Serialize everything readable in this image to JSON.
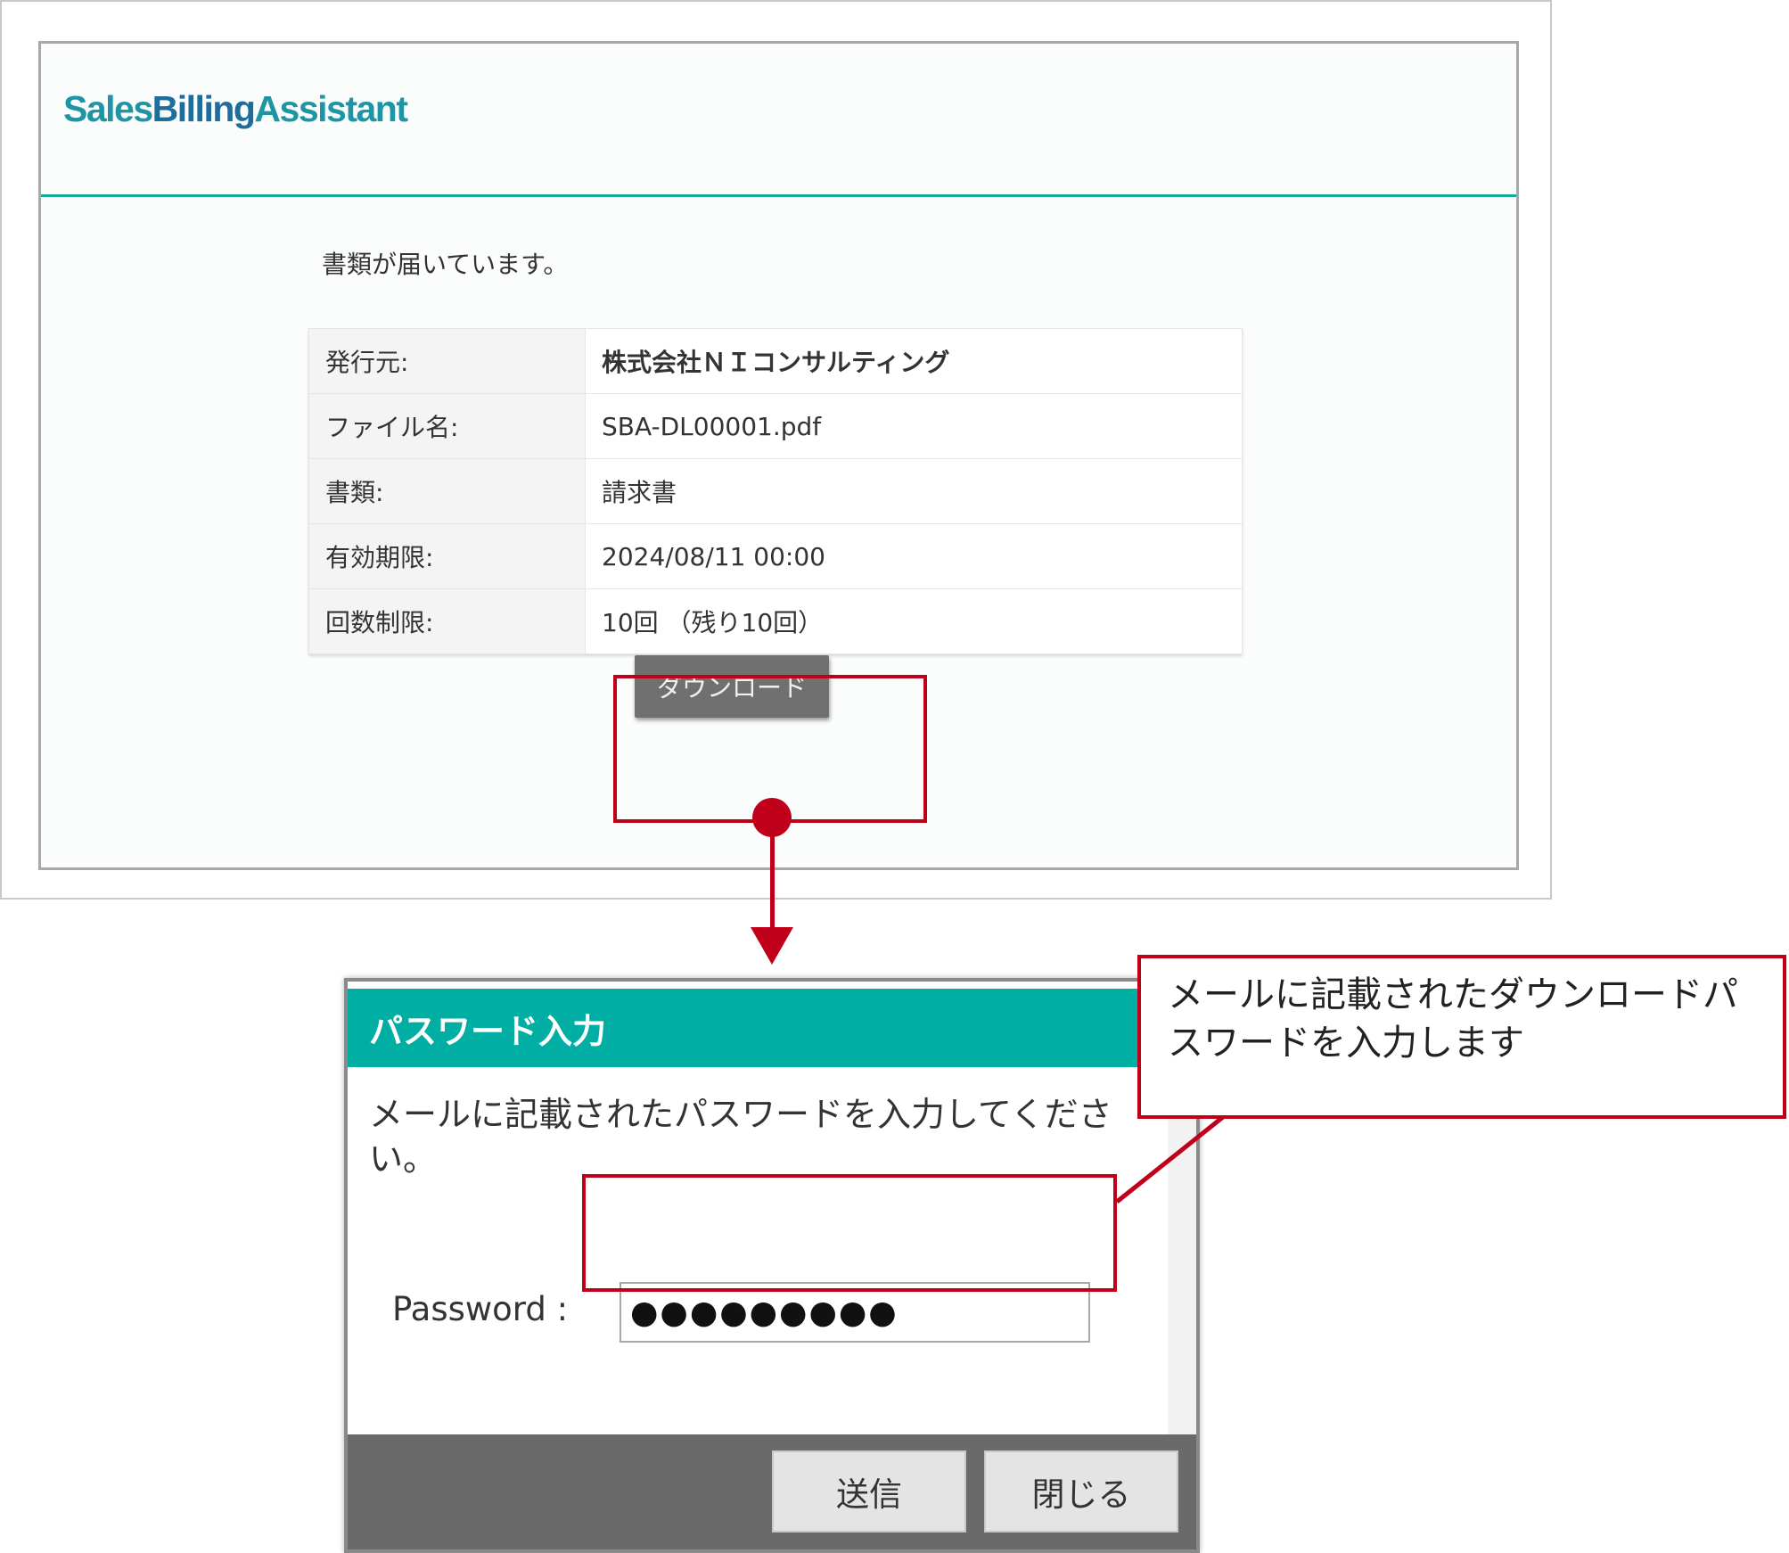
{
  "email": {
    "logo": {
      "part1": "Sales",
      "part2": "Billing",
      "part3": "Assistant"
    },
    "lead_text": "書類が届いています。",
    "rows": [
      {
        "label": "発行元:",
        "value": "株式会社ＮＩコンサルティング"
      },
      {
        "label": "ファイル名:",
        "value": "SBA-DL00001.pdf"
      },
      {
        "label": "書類:",
        "value": "請求書"
      },
      {
        "label": "有効期限:",
        "value": "2024/08/11 00:00"
      },
      {
        "label": "回数制限:",
        "value": "10回 （残り10回）"
      }
    ],
    "download_label": "ダウンロード"
  },
  "dialog": {
    "title": "パスワード入力",
    "message": "メールに記載されたパスワードを入力してください。",
    "password_label": "Password :",
    "password_value": "●●●●●●●●●",
    "send_label": "送信",
    "close_label": "閉じる"
  },
  "callout": {
    "text": "メールに記載されたダウンロードパスワードを入力します"
  },
  "colors": {
    "accent_teal": "#00aea4",
    "annotation_red": "#c0001a",
    "logo_blue": "#1f6d9d"
  },
  "icons": [
    "scroll-down-arrow-icon",
    "annotation-arrow-icon"
  ]
}
